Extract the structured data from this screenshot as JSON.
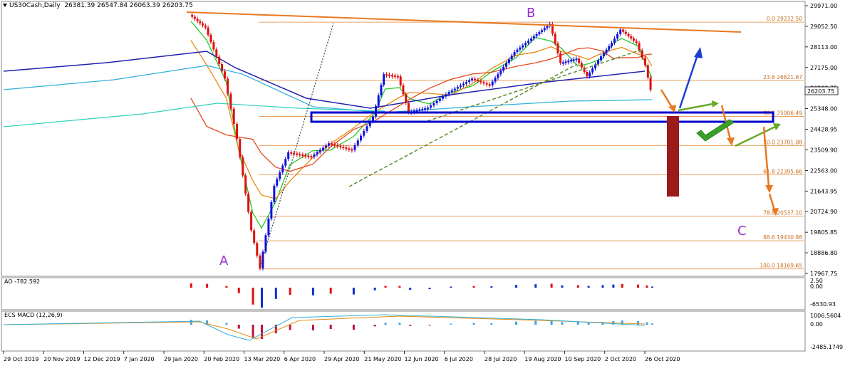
{
  "header": {
    "symbol": "US30Cash,Daily",
    "ohlc": "26381.39 26547.84 26063.39 26203.75"
  },
  "chart_data": {
    "type": "candlestick",
    "symbol": "US30Cash",
    "timeframe": "Daily",
    "ohlc_last": {
      "open": 26381.39,
      "high": 26547.84,
      "low": 26063.39,
      "close": 26203.75
    },
    "y_ticks": [
      "29971.00",
      "29052.50",
      "28113.00",
      "27175.00",
      "26203.75",
      "25348.00",
      "24428.95",
      "23509.90",
      "22563.00",
      "21643.95",
      "20724.90",
      "19805.85",
      "18886.80",
      "17967.75"
    ],
    "last_price": "26203.75",
    "x_ticks": [
      "29 Oct 2019",
      "20 Nov 2019",
      "12 Dec 2019",
      "7 Jan 2020",
      "29 Jan 2020",
      "20 Feb 2020",
      "13 Mar 2020",
      "6 Apr 2020",
      "29 Apr 2020",
      "21 May 2020",
      "12 Jun 2020",
      "6 Jul 2020",
      "28 Jul 2020",
      "19 Aug 2020",
      "10 Sep 2020",
      "2 Oct 2020",
      "26 Oct 2020"
    ],
    "fibonacci": [
      {
        "label": "0.0 29232.50",
        "price": 29232.5
      },
      {
        "label": "23.6 26621.67",
        "price": 26621.67
      },
      {
        "label": "38.2 25006.49",
        "price": 25006.49
      },
      {
        "label": "50.0 23701.08",
        "price": 23701.08
      },
      {
        "label": "61.8 22395.66",
        "price": 22395.66
      },
      {
        "label": "78.6 20537.10",
        "price": 20537.1
      },
      {
        "label": "88.6 19430.88",
        "price": 19430.88
      },
      {
        "label": "100.0 18169.65",
        "price": 18169.65
      }
    ],
    "wave_labels": [
      "A",
      "B",
      "C"
    ],
    "annotation_colors": {
      "trendline": "#e87820",
      "support_box": "#0000cc",
      "target_bar": "#9b1b1b",
      "arrow_up": "#1a3fd6",
      "arrow_green": "#6aa82a",
      "arrow_orange": "#e87820",
      "wave_label": "#9b30d0",
      "check": "#3aa02a"
    },
    "path_points": [
      {
        "date": "2020-02-12",
        "value": 29568
      },
      {
        "date": "2020-02-21",
        "value": 28992
      },
      {
        "date": "2020-03-03",
        "value": 26700
      },
      {
        "date": "2020-03-10",
        "value": 24000
      },
      {
        "date": "2020-03-18",
        "value": 19900
      },
      {
        "date": "2020-03-23",
        "value": 18200
      },
      {
        "date": "2020-03-31",
        "value": 21900
      },
      {
        "date": "2020-04-08",
        "value": 23400
      },
      {
        "date": "2020-04-21",
        "value": 23200
      },
      {
        "date": "2020-05-01",
        "value": 23800
      },
      {
        "date": "2020-05-14",
        "value": 23500
      },
      {
        "date": "2020-05-26",
        "value": 25000
      },
      {
        "date": "2020-06-01",
        "value": 26900
      },
      {
        "date": "2020-06-09",
        "value": 26800
      },
      {
        "date": "2020-06-15",
        "value": 25200
      },
      {
        "date": "2020-06-26",
        "value": 25400
      },
      {
        "date": "2020-07-08",
        "value": 26100
      },
      {
        "date": "2020-07-21",
        "value": 26700
      },
      {
        "date": "2020-07-31",
        "value": 26400
      },
      {
        "date": "2020-08-14",
        "value": 27900
      },
      {
        "date": "2020-08-25",
        "value": 28600
      },
      {
        "date": "2020-09-03",
        "value": 29150
      },
      {
        "date": "2020-09-09",
        "value": 27400
      },
      {
        "date": "2020-09-18",
        "value": 27600
      },
      {
        "date": "2020-09-24",
        "value": 26800
      },
      {
        "date": "2020-10-02",
        "value": 27700
      },
      {
        "date": "2020-10-08",
        "value": 28300
      },
      {
        "date": "2020-10-13",
        "value": 28900
      },
      {
        "date": "2020-10-22",
        "value": 28300
      },
      {
        "date": "2020-10-27",
        "value": 27300
      },
      {
        "date": "2020-10-30",
        "value": 26203.75
      }
    ],
    "ao": {
      "label": "AO -782.592",
      "y_ticks": [
        "2.50",
        "0.00",
        "-6530.93"
      ]
    },
    "macd": {
      "label": "ECS MACD (12,26,9)",
      "y_ticks": [
        "1006.5604",
        "0.00",
        "-2485.1749"
      ]
    }
  }
}
